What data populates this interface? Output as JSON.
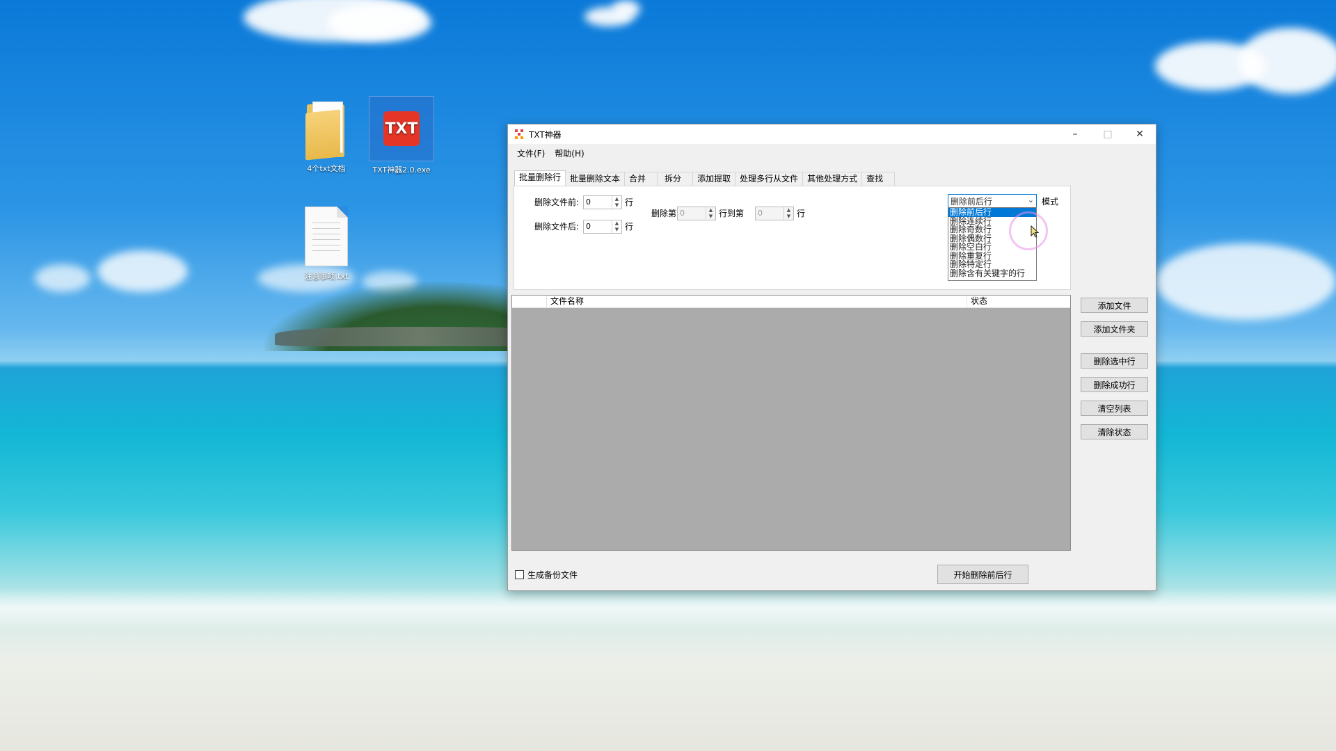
{
  "desktop": {
    "icons": [
      {
        "label": "4个txt文档"
      },
      {
        "label": "TXT神器2.0.exe",
        "badge": "TXT"
      },
      {
        "label": "注意事项.txt"
      }
    ]
  },
  "window": {
    "title": "TXT神器",
    "controls": {
      "minimize": "–",
      "maximize": "□",
      "close": "✕"
    },
    "menu": [
      {
        "label": "文件(F)"
      },
      {
        "label": "帮助(H)"
      }
    ],
    "tabs": [
      {
        "label": "批量删除行",
        "active": true
      },
      {
        "label": "批量删除文本"
      },
      {
        "label": "合并"
      },
      {
        "label": "拆分"
      },
      {
        "label": "添加提取"
      },
      {
        "label": "处理多行从文件"
      },
      {
        "label": "其他处理方式"
      },
      {
        "label": "查找"
      }
    ],
    "panel": {
      "delete_before_label": "删除文件前:",
      "delete_before_value": "0",
      "delete_after_label": "删除文件后:",
      "delete_after_value": "0",
      "unit": "行",
      "delete_from_label": "删除第",
      "delete_from_value": "0",
      "to_label": "行到第",
      "to_value": "0",
      "unit2": "行",
      "mode_label": "模式",
      "mode_value": "删除前后行",
      "mode_options": [
        {
          "label": "删除前后行",
          "selected": true
        },
        {
          "label": "删除连续行"
        },
        {
          "label": "删除奇数行"
        },
        {
          "label": "删除偶数行"
        },
        {
          "label": "删除空白行"
        },
        {
          "label": "删除重复行"
        },
        {
          "label": "删除特定行"
        },
        {
          "label": "删除含有关键字的行"
        }
      ]
    },
    "file_list": {
      "columns": [
        "",
        "文件名称",
        "状态"
      ],
      "rows": []
    },
    "buttons": {
      "add_file": "添加文件",
      "add_folder": "添加文件夹",
      "delete_selected": "删除选中行",
      "delete_success": "删除成功行",
      "clear_list": "清空列表",
      "clear_status": "清除状态"
    },
    "backup_checkbox": {
      "label": "生成备份文件",
      "checked": false
    },
    "start_button": "开始删除前后行"
  },
  "colors": {
    "accent": "#0078d7",
    "list_bg": "#ababab",
    "badge_red": "#e53527"
  }
}
